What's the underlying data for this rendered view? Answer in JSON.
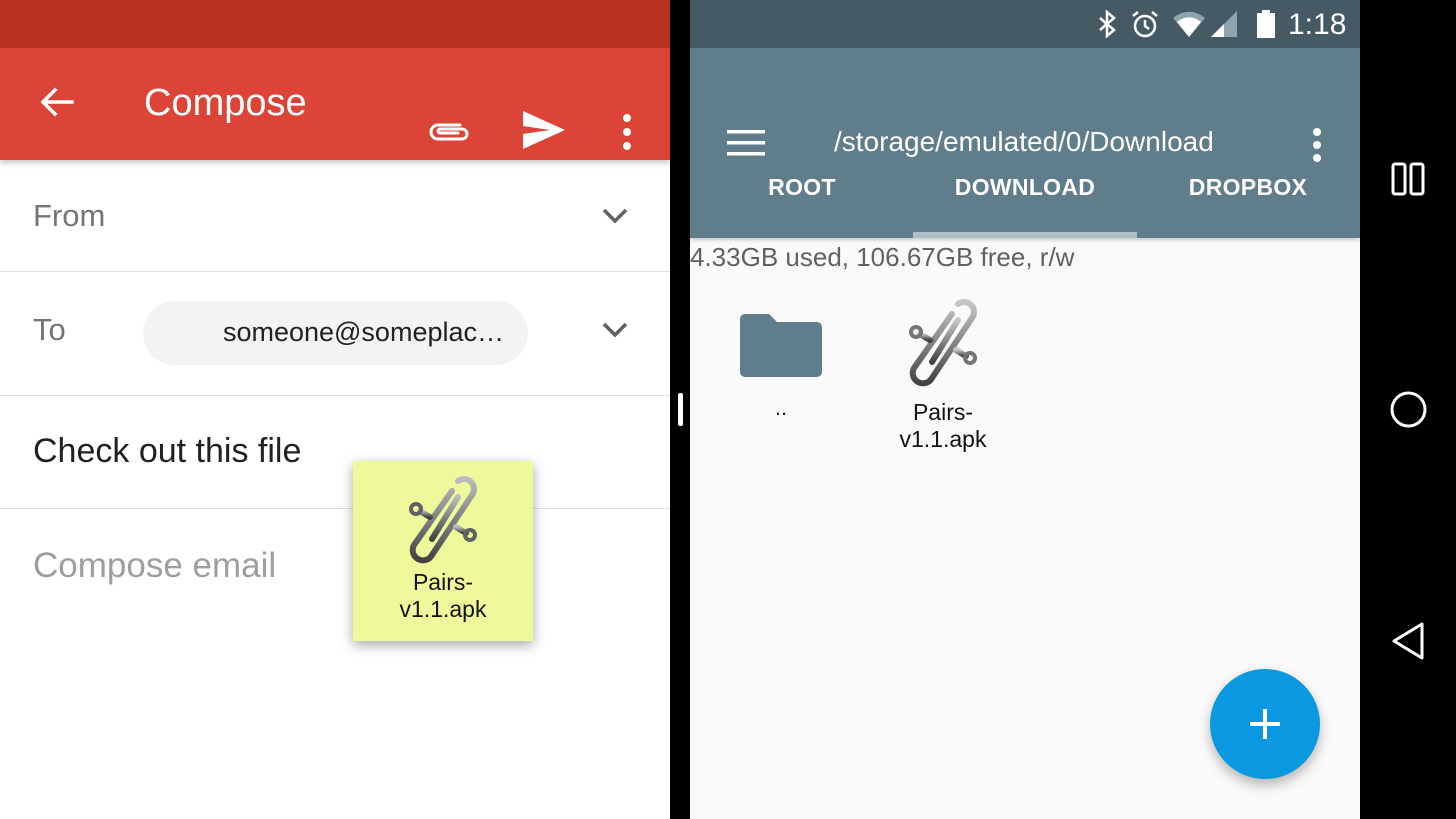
{
  "compose": {
    "title": "Compose",
    "icons": {
      "back": "arrow-back-icon",
      "attach": "attachment-icon",
      "send": "send-icon",
      "more": "more-vert-icon"
    },
    "from_label": "From",
    "to_label": "To",
    "to_chip": "someone@someplac…",
    "subject": "Check out this file",
    "body_placeholder": "Compose email"
  },
  "drag_item": {
    "name": "Pairs-\nv1.1.apk",
    "name_line1": "Pairs-",
    "name_line2": "v1.1.apk",
    "icon": "apk-clip-icon"
  },
  "file_manager": {
    "status_bar": {
      "time": "1:18",
      "icons": [
        "bluetooth-icon",
        "alarm-icon",
        "wifi-icon",
        "cell-signal-icon",
        "battery-icon"
      ]
    },
    "path": "/storage/emulated/0/Download",
    "tabs": [
      {
        "label": "ROOT",
        "active": false
      },
      {
        "label": "DOWNLOAD",
        "active": true
      },
      {
        "label": "DROPBOX",
        "active": false
      }
    ],
    "storage_info": "4.33GB used, 106.67GB free, r/w",
    "items": [
      {
        "name": "..",
        "type": "folder"
      },
      {
        "name_line1": "Pairs-",
        "name_line2": "v1.1.apk",
        "type": "apk"
      }
    ],
    "fab": "add-icon"
  },
  "navbar": {
    "buttons": [
      "recents-icon",
      "home-icon",
      "back-icon"
    ]
  },
  "colors": {
    "gmail_red": "#db4437",
    "gmail_status": "#b93221",
    "fm_toolbar": "#607d8b",
    "fm_status": "#455a64",
    "fab_blue": "#0a99e0",
    "drag_yellow": "#eef99c"
  }
}
